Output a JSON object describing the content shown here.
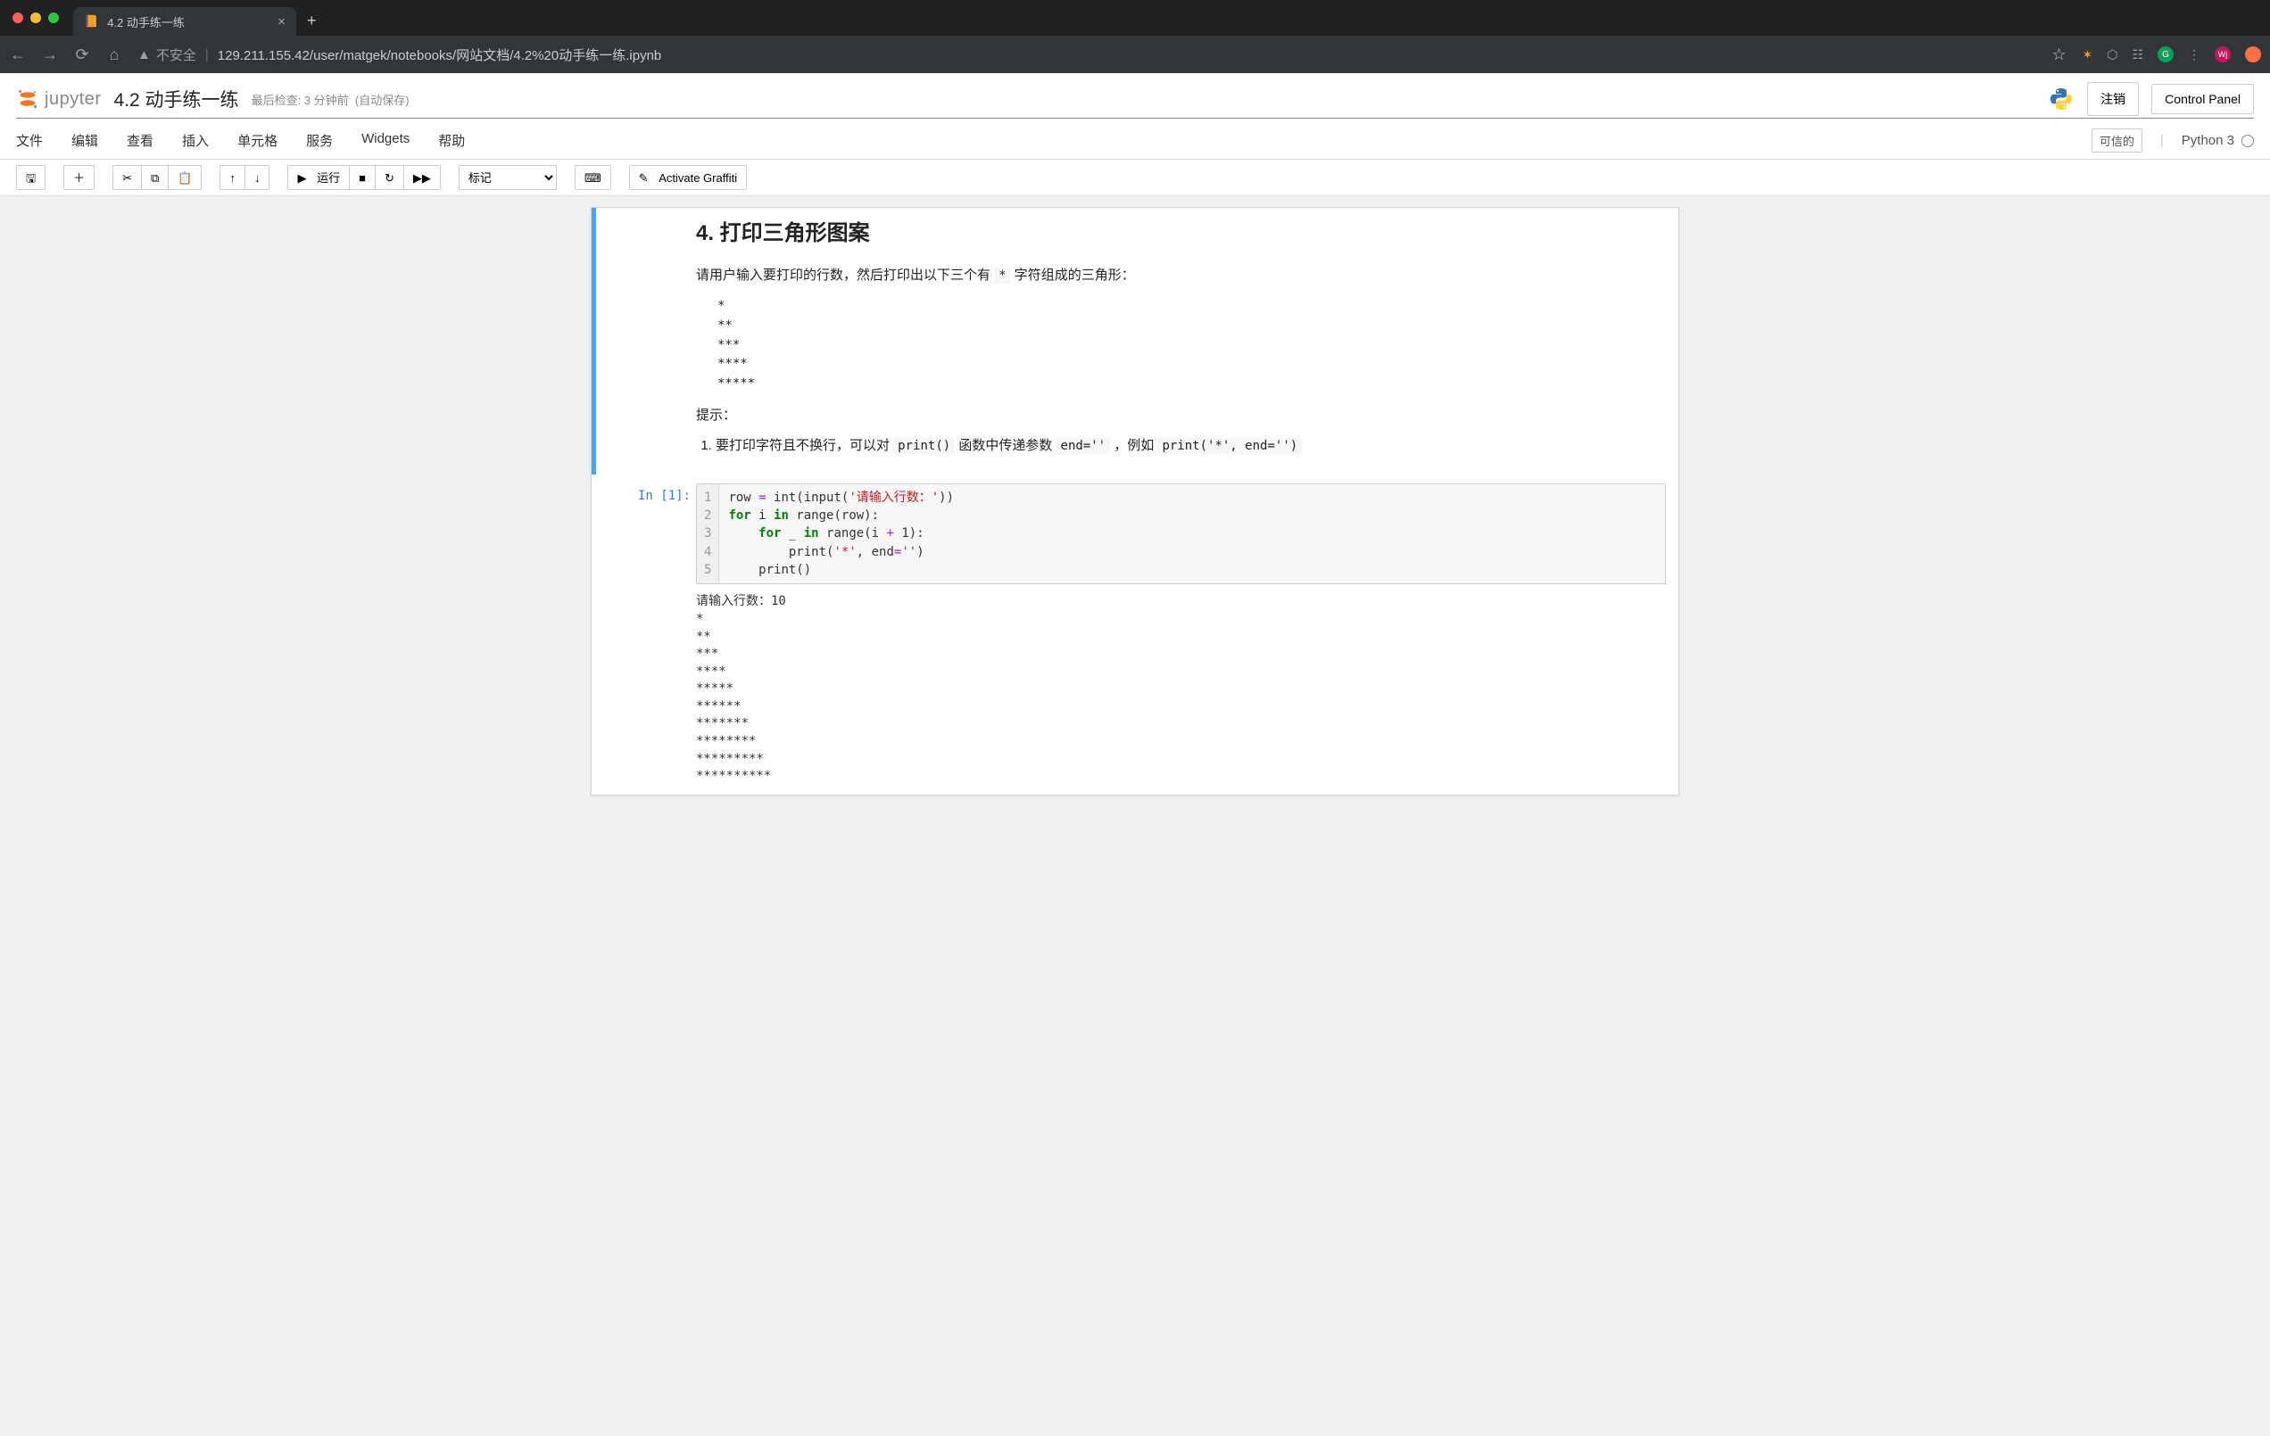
{
  "browser": {
    "tab_title": "4.2 动手练一练",
    "url_warning": "不安全",
    "url": "129.211.155.42/user/matgek/notebooks/网站文档/4.2%20动手练一练.ipynb"
  },
  "jupyter": {
    "logo_text": "jupyter",
    "notebook_title": "4.2 动手练一练",
    "autosave_prefix": "最后检查: 3 分钟前",
    "autosave_suffix": "(自动保存)",
    "logout": "注销",
    "control_panel": "Control Panel"
  },
  "menu": {
    "items": [
      "文件",
      "编辑",
      "查看",
      "插入",
      "单元格",
      "服务",
      "Widgets",
      "帮助"
    ],
    "trusted": "可信的",
    "kernel_name": "Python 3"
  },
  "toolbar": {
    "run": "运行",
    "celltype": "标记",
    "graffiti": "Activate Graffiti"
  },
  "markdown_cell": {
    "heading": "4. 打印三角形图案",
    "instruction_pre": "请用户输入要打印的行数，然后打印出以下三个有 ",
    "instruction_code": "*",
    "instruction_post": " 字符组成的三角形：",
    "pattern": "*\n**\n***\n****\n*****",
    "hint_label": "提示：",
    "tip_pre": "要打印字符且不换行，可以对 ",
    "tip_code1": "print()",
    "tip_mid": " 函数中传递参数 ",
    "tip_code2": "end=''",
    "tip_mid2": " ，例如 ",
    "tip_code3": "print('*', end='')"
  },
  "code_cell": {
    "prompt": "In [1]:",
    "source": {
      "l1": {
        "a": "row ",
        "op1": "=",
        "b": " int(input(",
        "str": "'请输入行数：'",
        "c": "))"
      },
      "l2": {
        "a": "for",
        "b": " i ",
        "c": "in",
        "d": " range(row):"
      },
      "l3": {
        "a": "    ",
        "b": "for",
        "c": " _ ",
        "d": "in",
        "e": " range(i ",
        "op": "+",
        "f": " 1):"
      },
      "l4": {
        "a": "        print(",
        "str": "'*'",
        "b": ", end",
        "op": "=",
        "str2": "''",
        "c": ")"
      },
      "l5": {
        "a": "    print()"
      }
    },
    "line_numbers": [
      "1",
      "2",
      "3",
      "4",
      "5"
    ],
    "output": "请输入行数：10\n*\n**\n***\n****\n*****\n******\n*******\n********\n*********\n**********"
  }
}
